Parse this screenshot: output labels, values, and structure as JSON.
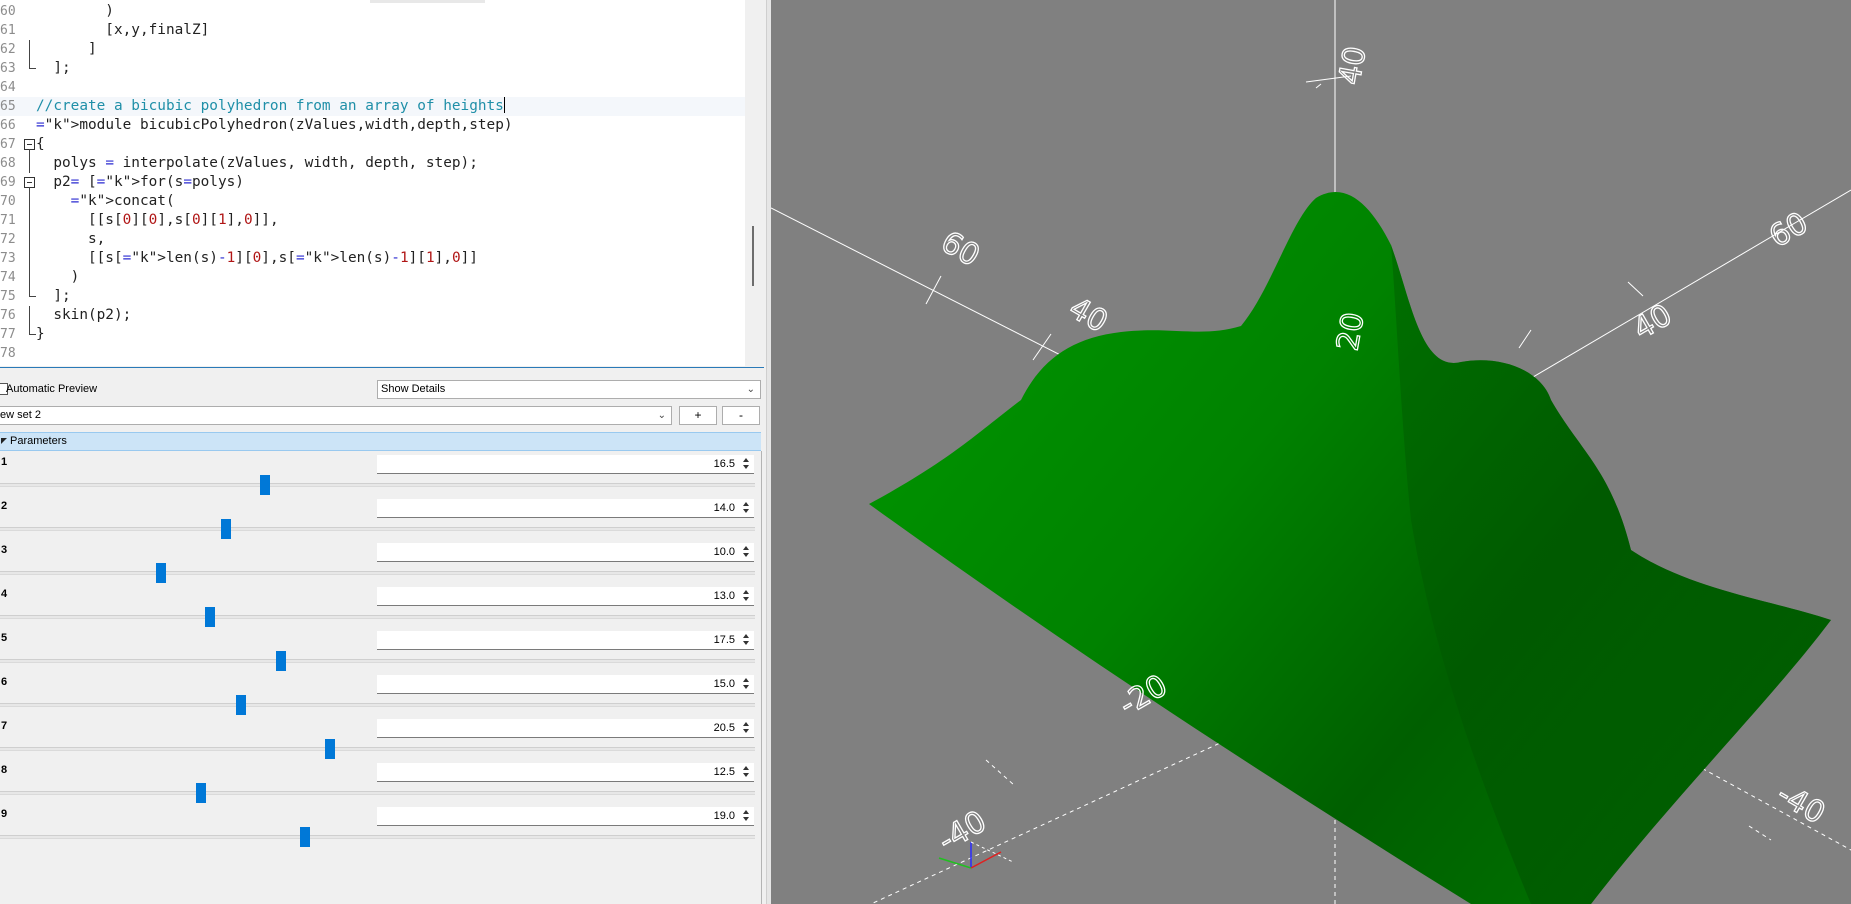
{
  "editor": {
    "lines": [
      {
        "num": "60",
        "text": "        )"
      },
      {
        "num": "61",
        "text": "        [x,y,finalZ]"
      },
      {
        "num": "62",
        "text": "      ]"
      },
      {
        "num": "63",
        "text": "  ];"
      },
      {
        "num": "64",
        "text": ""
      },
      {
        "num": "65",
        "text": "//create a bicubic polyhedron from an array of heights"
      },
      {
        "num": "66",
        "text": "module bicubicPolyhedron(zValues,width,depth,step)"
      },
      {
        "num": "67",
        "text": "{"
      },
      {
        "num": "68",
        "text": "  polys = interpolate(zValues, width, depth, step);"
      },
      {
        "num": "69",
        "text": "  p2= [for(s=polys)"
      },
      {
        "num": "70",
        "text": "    concat("
      },
      {
        "num": "71",
        "text": "      [[s[0][0],s[0][1],0]],"
      },
      {
        "num": "72",
        "text": "      s,"
      },
      {
        "num": "73",
        "text": "      [[s[len(s)-1][0],s[len(s)-1][1],0]]"
      },
      {
        "num": "74",
        "text": "    )"
      },
      {
        "num": "75",
        "text": "  ];"
      },
      {
        "num": "76",
        "text": "  skin(p2);"
      },
      {
        "num": "77",
        "text": "}"
      },
      {
        "num": "78",
        "text": ""
      }
    ]
  },
  "customizer": {
    "auto_preview_label": "Automatic Preview",
    "details_value": "Show Details",
    "preset_value": "ew set 2",
    "add_label": "+",
    "remove_label": "-",
    "group_label": "Parameters",
    "params": [
      {
        "label": "1",
        "value": "16.5",
        "slider": 0.345
      },
      {
        "label": "2",
        "value": "14.0",
        "slider": 0.293
      },
      {
        "label": "3",
        "value": "10.0",
        "slider": 0.207
      },
      {
        "label": "4",
        "value": "13.0",
        "slider": 0.272
      },
      {
        "label": "5",
        "value": "17.5",
        "slider": 0.366
      },
      {
        "label": "6",
        "value": "15.0",
        "slider": 0.313
      },
      {
        "label": "7",
        "value": "20.5",
        "slider": 0.43
      },
      {
        "label": "8",
        "value": "12.5",
        "slider": 0.26
      },
      {
        "label": "9",
        "value": "19.0",
        "slider": 0.398
      }
    ]
  },
  "viewport": {
    "axis_labels": [
      "40",
      "60",
      "40",
      "20",
      "60",
      "40",
      "-20",
      "-40",
      "-40"
    ],
    "model_color": "#008a00",
    "background": "#808080"
  }
}
